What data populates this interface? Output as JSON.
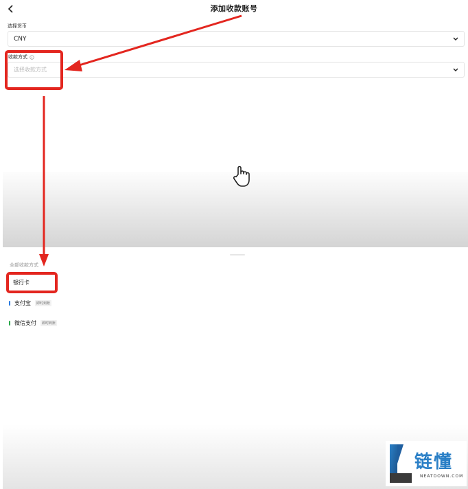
{
  "header": {
    "back_icon": "chevron-left-icon",
    "title": "添加收款账号"
  },
  "form": {
    "currency": {
      "label": "选择货币",
      "value": "CNY",
      "icon": "chevron-down-icon"
    },
    "method": {
      "label": "收款方式",
      "info_icon": "info-circle-icon",
      "placeholder": "选择收款方式",
      "icon": "chevron-down-icon"
    }
  },
  "sheet": {
    "title": "全部收款方式",
    "items": [
      {
        "label": "银行卡",
        "tag": ""
      },
      {
        "label": "支付宝",
        "tag": "即时到账",
        "color": "#2b7be0"
      },
      {
        "label": "微信支付",
        "tag": "即时到账",
        "color": "#2aa84a"
      }
    ]
  },
  "annotation": {
    "color": "#e3261f"
  },
  "watermark": {
    "brand": "链懂",
    "sub": "NEATDOWN.COM",
    "color": "#2a7fc6"
  }
}
